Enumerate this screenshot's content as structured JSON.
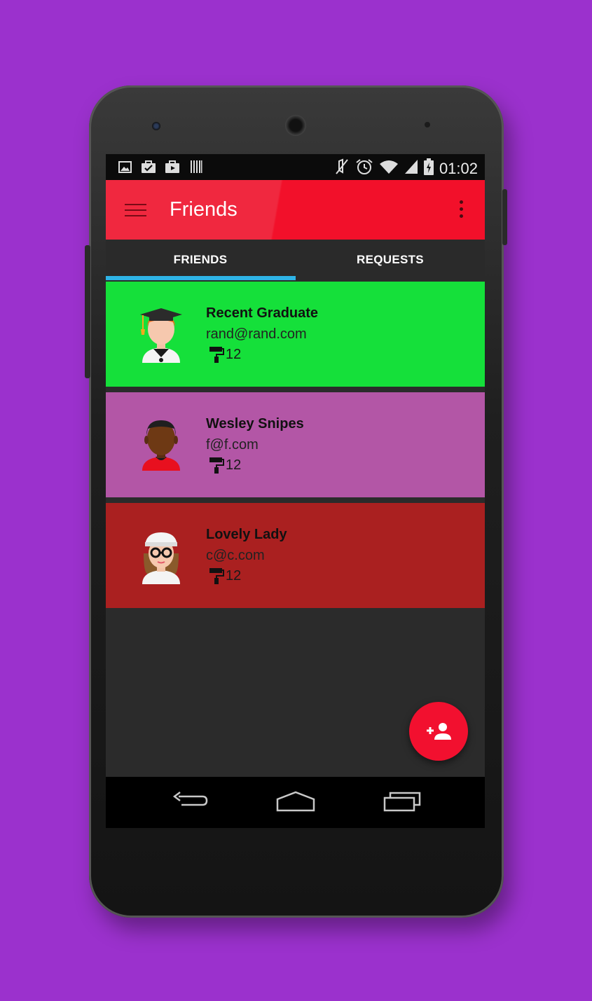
{
  "status_bar": {
    "time": "01:02",
    "left_icons": [
      "image-icon",
      "briefcase-check-icon",
      "briefcase-play-icon",
      "barcode-icon"
    ],
    "right_icons": [
      "mute-icon",
      "alarm-icon",
      "wifi-icon",
      "signal-icon",
      "battery-charging-icon"
    ]
  },
  "app_bar": {
    "title": "Friends"
  },
  "tabs": [
    {
      "label": "FRIENDS",
      "selected": true
    },
    {
      "label": "REQUESTS",
      "selected": false
    }
  ],
  "colors": {
    "background": "#9b31cd",
    "app_bar": "#f2102a",
    "tab_indicator": "#2eb3e6",
    "fab": "#f2102f"
  },
  "friends": [
    {
      "name": "Recent Graduate",
      "email": "rand@rand.com",
      "count": "12",
      "color": "#15e03a",
      "avatar": "graduate-avatar"
    },
    {
      "name": "Wesley Snipes",
      "email": "f@f.com",
      "count": "12",
      "color": "#b356a6",
      "avatar": "man-avatar"
    },
    {
      "name": "Lovely Lady",
      "email": "c@c.com",
      "count": "12",
      "color": "#aa2020",
      "avatar": "woman-avatar"
    }
  ],
  "fab": {
    "icon": "add-person-icon"
  },
  "nav_bar": {
    "icons": [
      "back-icon",
      "home-icon",
      "recents-icon"
    ]
  }
}
